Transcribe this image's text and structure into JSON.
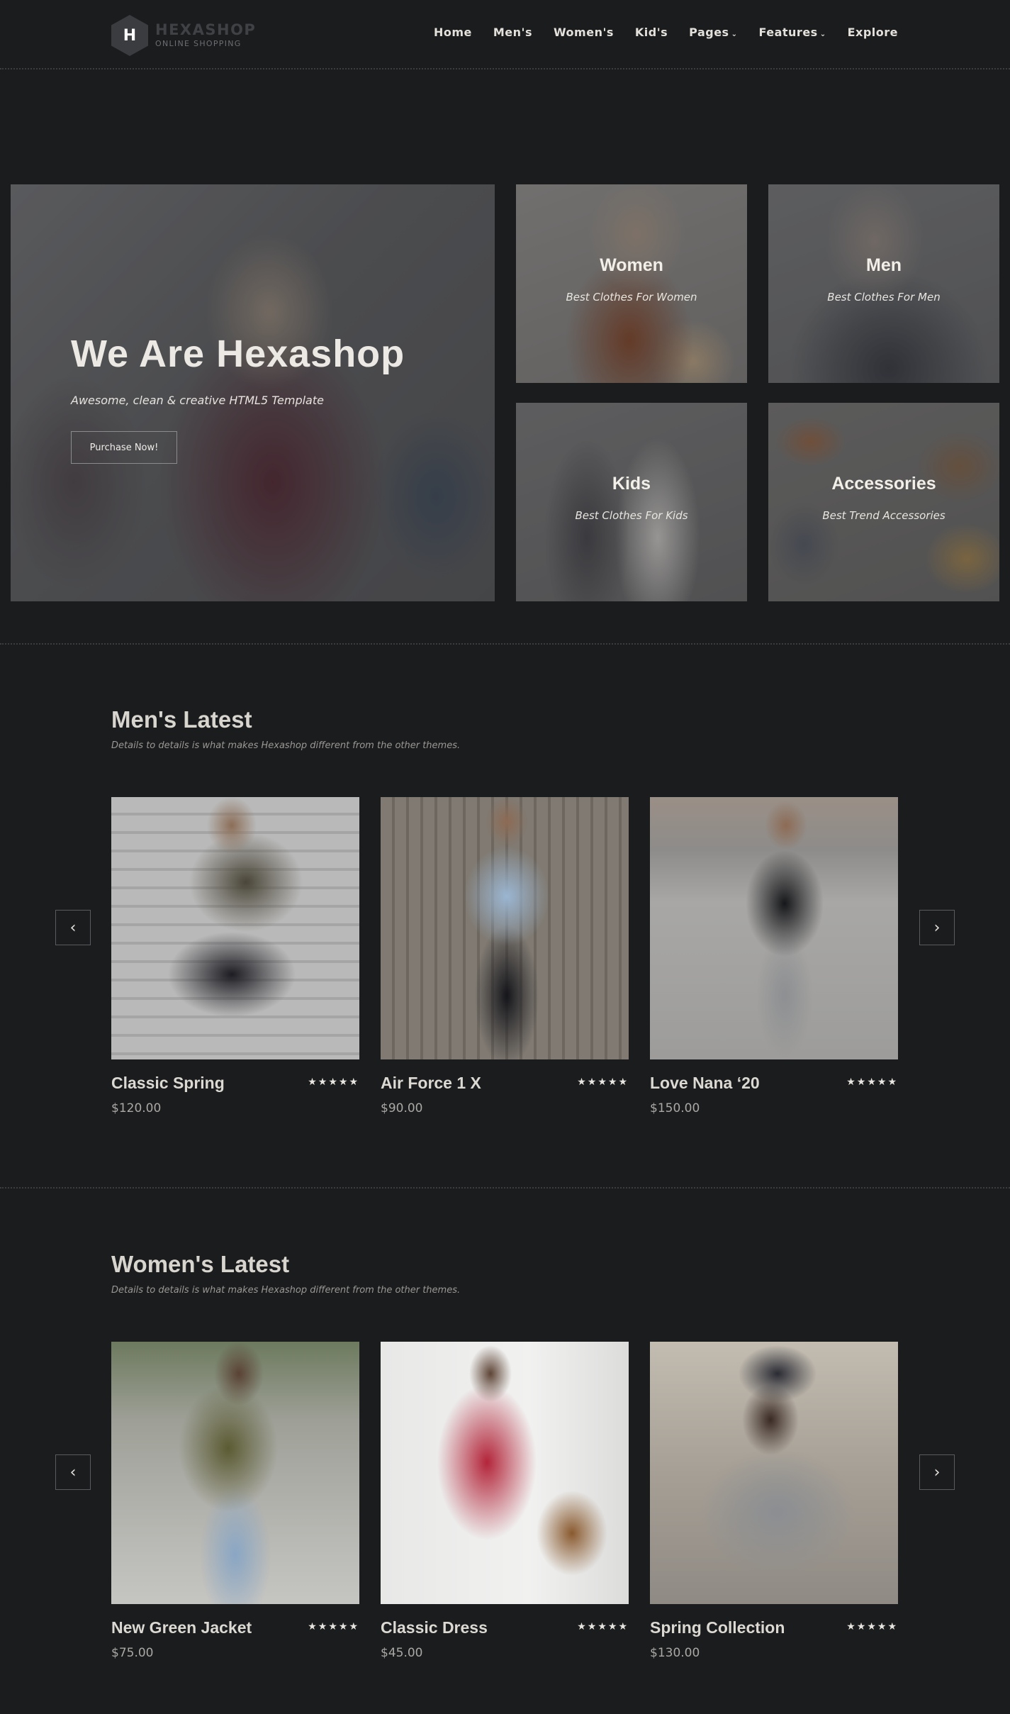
{
  "brand": {
    "logo_letter": "H",
    "name": "HEXASHOP",
    "tagline": "ONLINE SHOPPING"
  },
  "nav": {
    "items": [
      {
        "label": "Home"
      },
      {
        "label": "Men's"
      },
      {
        "label": "Women's"
      },
      {
        "label": "Kid's"
      },
      {
        "label": "Pages",
        "dropdown": true
      },
      {
        "label": "Features",
        "dropdown": true
      },
      {
        "label": "Explore"
      }
    ]
  },
  "hero": {
    "title": "We Are Hexashop",
    "subtitle": "Awesome, clean & creative HTML5 Template",
    "button": "Purchase Now!"
  },
  "categories": [
    {
      "title": "Women",
      "subtitle": "Best Clothes For Women"
    },
    {
      "title": "Men",
      "subtitle": "Best Clothes For Men"
    },
    {
      "title": "Kids",
      "subtitle": "Best Clothes For Kids"
    },
    {
      "title": "Accessories",
      "subtitle": "Best Trend Accessories"
    }
  ],
  "mens_latest": {
    "title": "Men's Latest",
    "subtitle": "Details to details is what makes Hexashop different from the other themes.",
    "products": [
      {
        "name": "Classic Spring",
        "price": "$120.00",
        "rating": 5
      },
      {
        "name": "Air Force 1 X",
        "price": "$90.00",
        "rating": 5
      },
      {
        "name": "Love Nana ‘20",
        "price": "$150.00",
        "rating": 5
      }
    ]
  },
  "womens_latest": {
    "title": "Women's Latest",
    "subtitle": "Details to details is what makes Hexashop different from the other themes.",
    "products": [
      {
        "name": "New Green Jacket",
        "price": "$75.00",
        "rating": 5
      },
      {
        "name": "Classic Dress",
        "price": "$45.00",
        "rating": 5
      },
      {
        "name": "Spring Collection",
        "price": "$130.00",
        "rating": 5
      }
    ]
  },
  "icons": {
    "prev": "chevron-left-icon",
    "next": "chevron-right-icon",
    "star": "star-icon",
    "dropdown": "chevron-down-icon"
  },
  "colors": {
    "background": "#1b1c1e",
    "text": "#ddd9d2",
    "muted": "#9a9894"
  }
}
